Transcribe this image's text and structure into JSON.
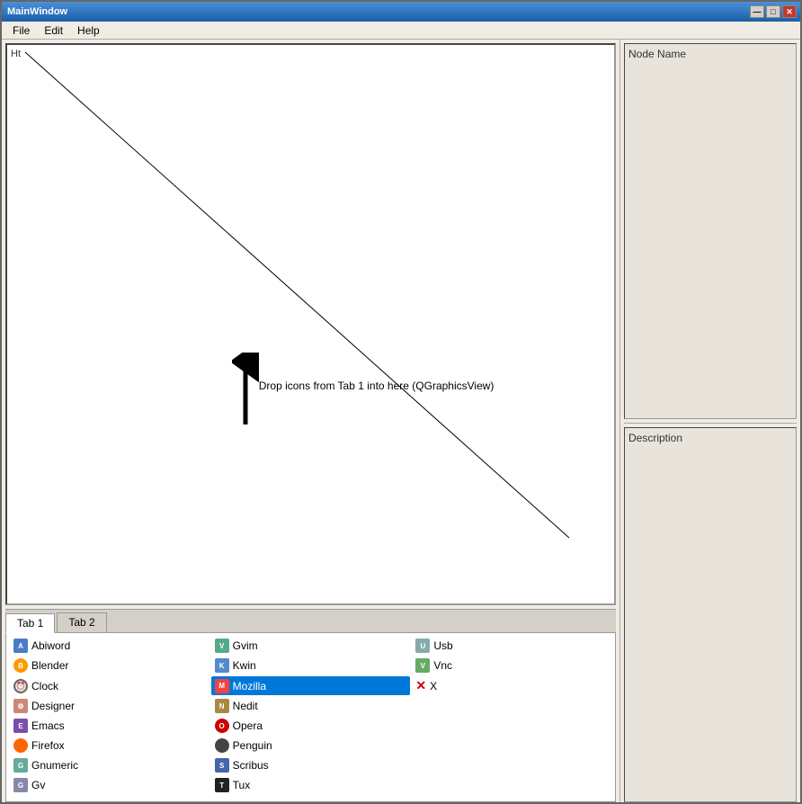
{
  "window": {
    "title": "MainWindow",
    "controls": {
      "minimize": "—",
      "maximize": "□",
      "close": "✕"
    }
  },
  "menubar": {
    "items": [
      "File",
      "Edit",
      "Help"
    ]
  },
  "graphics_view": {
    "label": "Ht",
    "drop_instruction": "Drop icons from Tab 1 into here (QGraphicsView)"
  },
  "tabs": [
    {
      "id": "tab1",
      "label": "Tab 1",
      "active": true
    },
    {
      "id": "tab2",
      "label": "Tab 2",
      "active": false
    }
  ],
  "tab1_icons": [
    {
      "name": "Abiword",
      "icon_type": "abiword",
      "glyph": "A",
      "col": 0
    },
    {
      "name": "Blender",
      "icon_type": "blender",
      "glyph": "B",
      "col": 0
    },
    {
      "name": "Clock",
      "icon_type": "clock",
      "glyph": "⏰",
      "col": 0
    },
    {
      "name": "Designer",
      "icon_type": "designer",
      "glyph": "⚙",
      "col": 0
    },
    {
      "name": "Emacs",
      "icon_type": "emacs",
      "glyph": "E",
      "col": 0
    },
    {
      "name": "Firefox",
      "icon_type": "firefox",
      "glyph": "🦊",
      "col": 0
    },
    {
      "name": "Gnumeric",
      "icon_type": "gnumeric",
      "glyph": "G",
      "col": 0
    },
    {
      "name": "Gv",
      "icon_type": "gv",
      "glyph": "G",
      "col": 0
    },
    {
      "name": "Gvim",
      "icon_type": "gvim",
      "glyph": "V",
      "col": 1
    },
    {
      "name": "Kwin",
      "icon_type": "kwin",
      "glyph": "K",
      "col": 1
    },
    {
      "name": "Mozilla",
      "icon_type": "mozilla",
      "glyph": "M",
      "col": 1,
      "selected": true
    },
    {
      "name": "Nedit",
      "icon_type": "nedit",
      "glyph": "N",
      "col": 1
    },
    {
      "name": "Opera",
      "icon_type": "opera",
      "glyph": "O",
      "col": 1
    },
    {
      "name": "Penguin",
      "icon_type": "penguin",
      "glyph": "🐧",
      "col": 1
    },
    {
      "name": "Scribus",
      "icon_type": "scribus",
      "glyph": "S",
      "col": 1
    },
    {
      "name": "Tux",
      "icon_type": "tux",
      "glyph": "T",
      "col": 1
    },
    {
      "name": "Usb",
      "icon_type": "usb",
      "glyph": "U",
      "col": 2
    },
    {
      "name": "Vnc",
      "icon_type": "vnc",
      "glyph": "V",
      "col": 2
    },
    {
      "name": "X",
      "icon_type": "x",
      "glyph": "✕",
      "col": 2,
      "is_x": true
    }
  ],
  "right_panel": {
    "node_name_label": "Node Name",
    "description_label": "Description"
  }
}
